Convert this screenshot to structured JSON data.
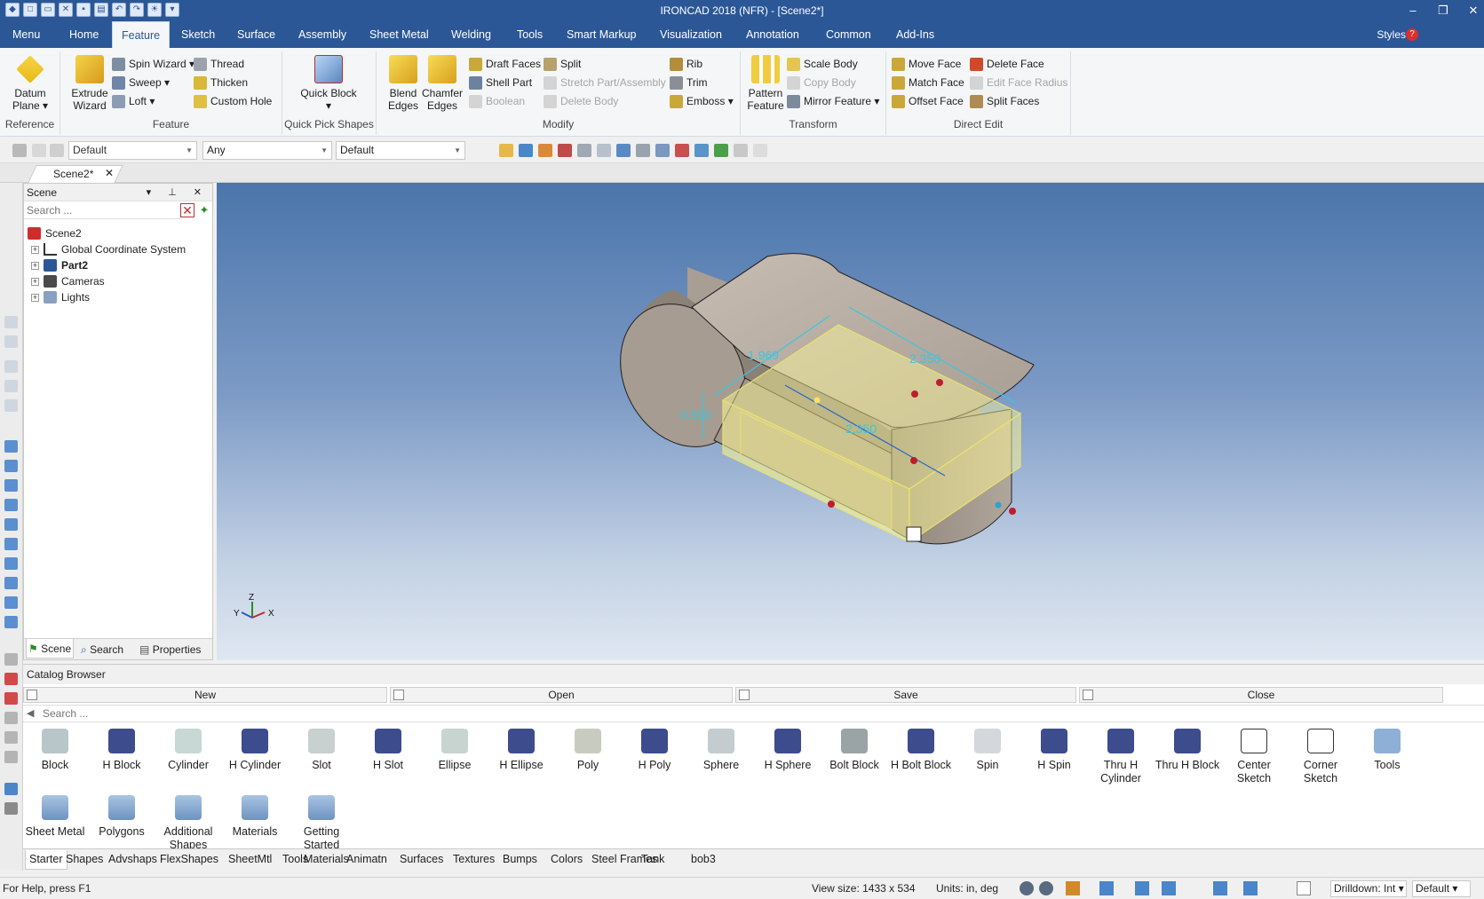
{
  "window": {
    "title": "IRONCAD 2018 (NFR) - [Scene2*]",
    "minimize": "‒",
    "restore": "❐",
    "close": "✕"
  },
  "menubar": {
    "tabs": [
      "Menu",
      "Home",
      "Feature",
      "Sketch",
      "Surface",
      "Assembly",
      "Sheet Metal",
      "Welding",
      "Tools",
      "Smart Markup",
      "Visualization",
      "Annotation",
      "Common",
      "Add-Ins"
    ],
    "active_tab": "Feature",
    "styles_label": "Styles"
  },
  "ribbon": {
    "reference": {
      "group_label": "Reference",
      "datum_plane": "Datum Plane"
    },
    "feature": {
      "group_label": "Feature",
      "extrude_wizard": "Extrude Wizard",
      "spin_wizard": "Spin Wizard",
      "sweep": "Sweep",
      "loft": "Loft",
      "thread": "Thread",
      "thicken": "Thicken",
      "custom_hole": "Custom Hole"
    },
    "quick_pick": {
      "group_label": "Quick Pick Shapes",
      "quick_block": "Quick Block"
    },
    "modify": {
      "group_label": "Modify",
      "blend_edges": "Blend Edges",
      "chamfer_edges": "Chamfer Edges",
      "draft_faces": "Draft Faces",
      "shell_part": "Shell Part",
      "boolean": "Boolean",
      "split": "Split",
      "stretch": "Stretch Part/Assembly",
      "delete_body": "Delete Body",
      "rib": "Rib",
      "trim": "Trim",
      "emboss": "Emboss"
    },
    "transform": {
      "group_label": "Transform",
      "pattern_feature": "Pattern Feature",
      "scale_body": "Scale Body",
      "copy_body": "Copy Body",
      "mirror_feature": "Mirror Feature"
    },
    "direct_edit": {
      "group_label": "Direct Edit",
      "move_face": "Move Face",
      "match_face": "Match Face",
      "offset_face": "Offset Face",
      "delete_face": "Delete Face",
      "edit_face_radius": "Edit Face Radius",
      "split_faces": "Split Faces"
    }
  },
  "toolbar": {
    "combo1": "Default",
    "combo2": "Any",
    "combo3": "Default"
  },
  "doc_tab": {
    "label": "Scene2*",
    "close": "✕"
  },
  "scene_panel": {
    "title": "Scene",
    "buttons": "▾ ⊥ ✕",
    "search_placeholder": "Search ...",
    "tree": [
      "Scene2",
      "Global Coordinate System",
      "Part2",
      "Cameras",
      "Lights"
    ],
    "tabs": [
      "Scene",
      "Search",
      "Properties"
    ]
  },
  "viewport": {
    "dimensions": [
      "1.969",
      "0.500",
      "2.350",
      "2.350"
    ],
    "axes": {
      "z": "Z",
      "y": "Y",
      "x": "X"
    }
  },
  "catalog": {
    "title": "Catalog Browser",
    "buttons": [
      "New",
      "Open",
      "Save",
      "Close"
    ],
    "search_placeholder": "Search ...",
    "items_row1": [
      "Block",
      "H Block",
      "Cylinder",
      "H Cylinder",
      "Slot",
      "H Slot",
      "Ellipse",
      "H Ellipse",
      "Poly",
      "H Poly",
      "Sphere",
      "H Sphere",
      "Bolt Block",
      "H Bolt Block",
      "Spin",
      "H Spin",
      "Thru H Cylinder",
      "Thru H Block",
      "Center Sketch",
      "Corner Sketch",
      "Tools"
    ],
    "items_row2": [
      "Sheet Metal",
      "Polygons",
      "Additional Shapes",
      "Materials",
      "Getting Started"
    ],
    "tabs": [
      "Starter",
      "Shapes",
      "Advshaps",
      "FlexShapes",
      "SheetMtl",
      "Tools",
      "Materials",
      "Animatn",
      "Surfaces",
      "Textures",
      "Bumps",
      "Colors",
      "Steel Frames",
      "Tank",
      "bob3"
    ],
    "active_tab": "Starter"
  },
  "status": {
    "help": "For Help, press F1",
    "view_size": "View size: 1433 x  534",
    "units": "Units: in, deg",
    "drilldown": "Drilldown: Int",
    "default": "Default"
  }
}
